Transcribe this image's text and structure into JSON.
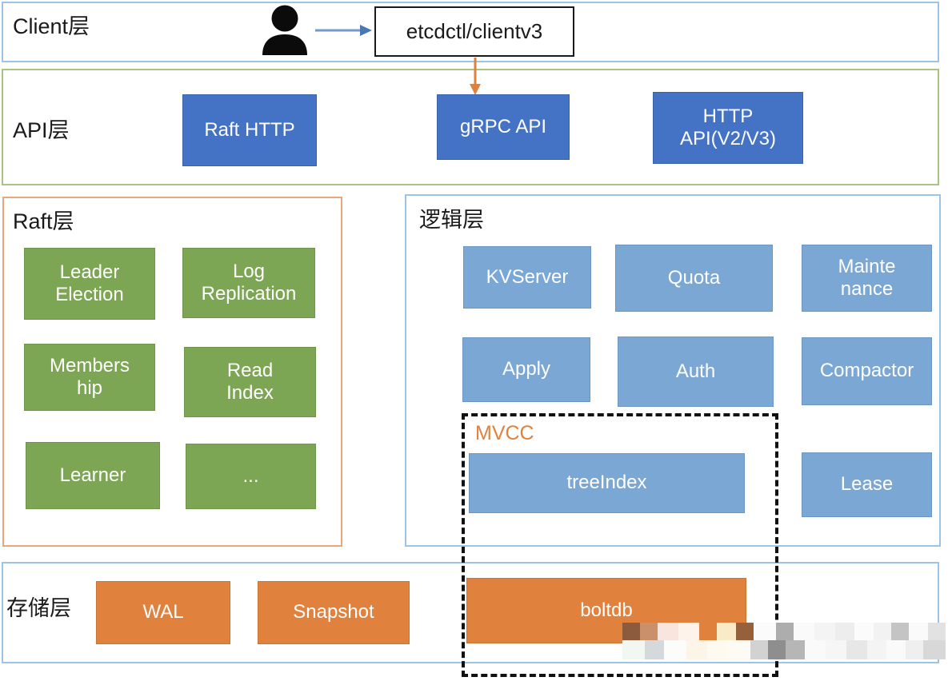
{
  "diagram": {
    "title": "etcd architecture layers",
    "colors": {
      "blue_dark": "#4472C4",
      "blue_light": "#7BA7D4",
      "green": "#7CA653",
      "orange": "#E0823E",
      "client_border": "#9DC3E6",
      "api_border": "#A9C47F",
      "raft_border": "#E8A87C",
      "logic_border": "#9DC3E6",
      "storage_border": "#9DC3E6",
      "mvcc_label": "#E0823E",
      "arrow_client": "#7699C8",
      "arrow_api": "#E0823E"
    }
  },
  "client_layer": {
    "label": "Client层",
    "person_icon": "user-icon",
    "arrow_icon": "right-arrow-icon",
    "client_box": "etcdctl/clientv3"
  },
  "api_layer": {
    "label": "API层",
    "arrow_icon": "down-arrow-icon",
    "nodes": [
      {
        "label": "Raft HTTP"
      },
      {
        "label": "gRPC API"
      },
      {
        "label": "HTTP\nAPI(V2/V3)",
        "line1": "HTTP",
        "line2": "API(V2/V3)"
      }
    ]
  },
  "raft_layer": {
    "label": "Raft层",
    "nodes": [
      {
        "line1": "Leader",
        "line2": "Election"
      },
      {
        "line1": "Log",
        "line2": "Replication"
      },
      {
        "line1": "Members",
        "line2": "hip"
      },
      {
        "line1": "Read",
        "line2": "Index"
      },
      {
        "line1": "Learner",
        "line2": ""
      },
      {
        "line1": "...",
        "line2": ""
      }
    ]
  },
  "logic_layer": {
    "label": "逻辑层",
    "nodes": [
      {
        "line1": "KVServer",
        "line2": ""
      },
      {
        "line1": "Quota",
        "line2": ""
      },
      {
        "line1": "Mainte",
        "line2": "nance"
      },
      {
        "line1": "Apply",
        "line2": ""
      },
      {
        "line1": "Auth",
        "line2": ""
      },
      {
        "line1": "Compactor",
        "line2": ""
      },
      {
        "line1": "treeIndex",
        "line2": ""
      },
      {
        "line1": "Lease",
        "line2": ""
      }
    ]
  },
  "mvcc_group": {
    "label": "MVCC"
  },
  "storage_layer": {
    "label": "存储层",
    "nodes": [
      {
        "label": "WAL"
      },
      {
        "label": "Snapshot"
      },
      {
        "label": "boltdb"
      }
    ]
  },
  "censor": {
    "name": "mosaic-censor-overlay"
  }
}
